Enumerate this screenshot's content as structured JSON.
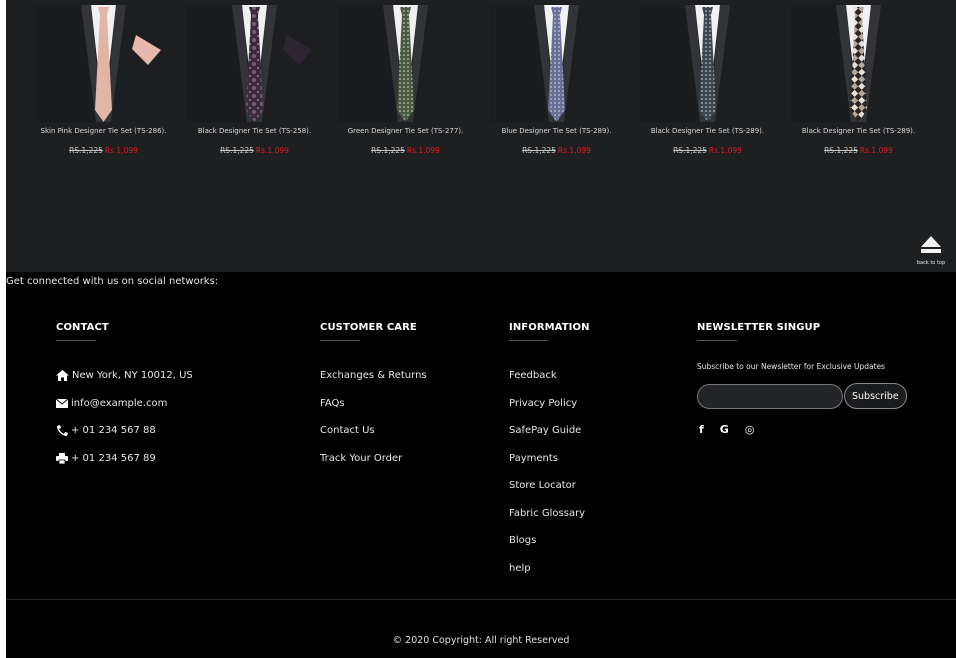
{
  "products": [
    {
      "name": "Skin Pink Designer Tie Set (TS-286).",
      "old_price": "RS.1,225",
      "new_price": "Rs.1,099",
      "tie_color": "#e3b7aa",
      "pattern": "plain",
      "pocket": "#e6b9ad"
    },
    {
      "name": "Black Designer Tie Set (TS-258).",
      "old_price": "RS.1,225",
      "new_price": "Rs.1,099",
      "tie_color": "#3a2a3a",
      "pattern": "paisley",
      "pocket": "#2d2530"
    },
    {
      "name": "Green Designer Tie Set (TS-277).",
      "old_price": "RS.1,225",
      "new_price": "Rs.1,099",
      "tie_color": "#4a5a3e",
      "pattern": "dots",
      "pocket": ""
    },
    {
      "name": "Blue Designer Tie Set (TS-289).",
      "old_price": "RS.1,225",
      "new_price": "Rs.1,099",
      "tie_color": "#6a6f98",
      "pattern": "dots",
      "pocket": ""
    },
    {
      "name": "Black Designer Tie Set (TS-289).",
      "old_price": "RS.1,225",
      "new_price": "Rs.1,099",
      "tie_color": "#3d4650",
      "pattern": "dots",
      "pocket": ""
    },
    {
      "name": "Black Designer Tie Set (TS-289).",
      "old_price": "RS.1,225",
      "new_price": "Rs.1,099",
      "tie_color": "#7a6258",
      "pattern": "check",
      "pocket": ""
    }
  ],
  "back_to_top": {
    "label": "back to top",
    "icon": "eject-icon"
  },
  "social_line": "Get connected with us on social networks:",
  "contact": {
    "title": "CONTACT",
    "items": [
      {
        "icon": "home-icon",
        "text": "New York, NY 10012, US"
      },
      {
        "icon": "envelope-icon",
        "text": "info@example.com"
      },
      {
        "icon": "phone-icon",
        "text": "+ 01 234 567 88"
      },
      {
        "icon": "printer-icon",
        "text": "+ 01 234 567 89"
      }
    ]
  },
  "customer_care": {
    "title": "CUSTOMER CARE",
    "items": [
      "Exchanges & Returns",
      "FAQs",
      "Contact Us",
      "Track Your Order"
    ]
  },
  "information": {
    "title": "INFORMATION",
    "items": [
      "Feedback",
      "Privacy Policy",
      "SafePay Guide",
      "Payments",
      "Store Locator",
      "Fabric Glossary",
      "Blogs",
      "help"
    ]
  },
  "newsletter": {
    "title": "NEWSLETTER SINGUP",
    "text": "Subscribe to our Newsletter for Exclusive Updates",
    "input_value": "",
    "button": "Subscribe",
    "social": [
      {
        "icon": "facebook-icon",
        "glyph": "f"
      },
      {
        "icon": "google-icon",
        "glyph": "G"
      },
      {
        "icon": "instagram-icon",
        "glyph": "◎"
      }
    ]
  },
  "copyright": "© 2020 Copyright: All right Reserved"
}
